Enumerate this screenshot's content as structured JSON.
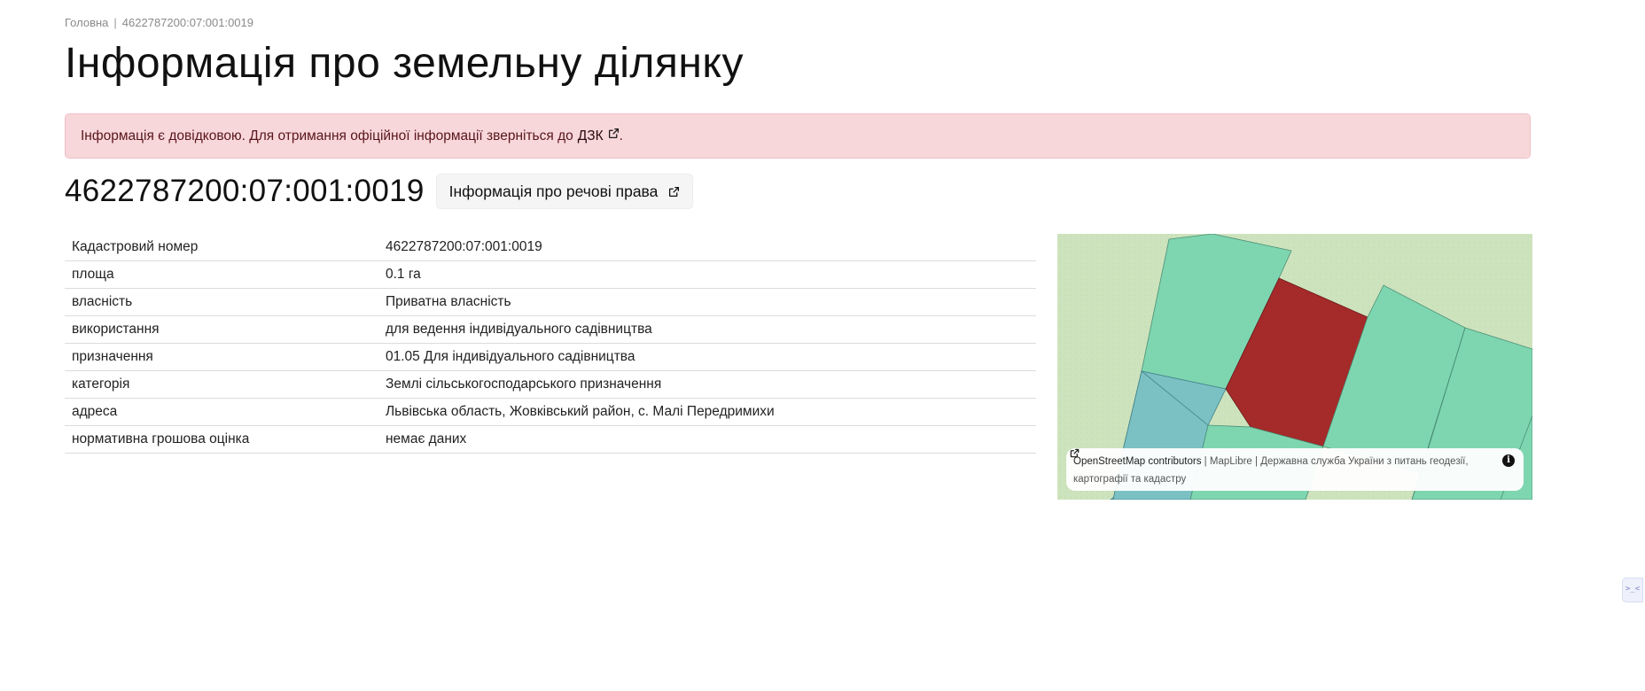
{
  "breadcrumb": {
    "home": "Головна",
    "separator": "|",
    "current": "4622787200:07:001:0019"
  },
  "page_title": "Інформація про земельну ділянку",
  "alert": {
    "text": "Інформація є довідковою. Для отримання офіційної інформації зверніться до",
    "link_text": "ДЗК",
    "suffix": ".",
    "icon": "external-link-icon"
  },
  "parcel": {
    "number": "4622787200:07:001:0019",
    "rights_button_label": "Інформація про речові права"
  },
  "properties": [
    {
      "key": "Кадастровий номер",
      "value": "4622787200:07:001:0019"
    },
    {
      "key": "площа",
      "value": "0.1 га"
    },
    {
      "key": "власність",
      "value": "Приватна власність"
    },
    {
      "key": "використання",
      "value": "для ведення індивідуального садівництва"
    },
    {
      "key": "призначення",
      "value": "01.05 Для індивідуального садівництва"
    },
    {
      "key": "категорія",
      "value": "Землі сільськогосподарського призначення"
    },
    {
      "key": "адреса",
      "value": "Львівська область, Жовківський район, с. Малі Передримихи"
    },
    {
      "key": "нормативна грошова оцінка",
      "value": "немає даних"
    }
  ],
  "map": {
    "attribution": {
      "osm": "OpenStreetMap contributors",
      "sep1": "|",
      "maplibre": "MapLibre",
      "sep2": "|",
      "dzk": "Державна служба України з питань геодезії, картографії та кадастру"
    },
    "info_icon": "i",
    "colors": {
      "background": "#cde3bd",
      "parcel_selected": "#a52a2a",
      "parcel_green": "#7ed6b0",
      "parcel_teal": "#7bc1c4"
    }
  },
  "side_widget": {
    "label": ">_<",
    "icon": "assistant-icon"
  }
}
